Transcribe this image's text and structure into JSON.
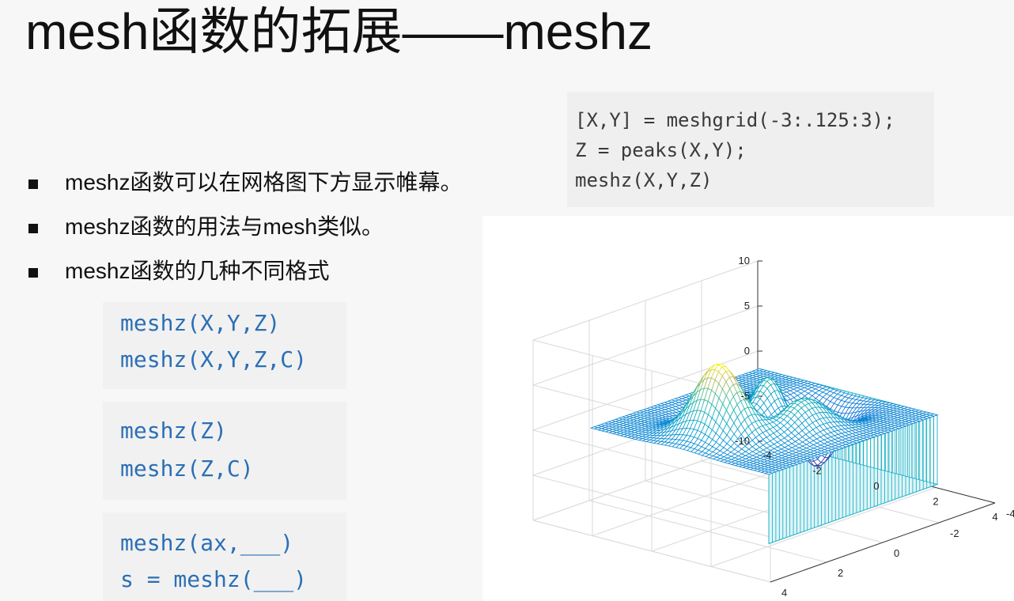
{
  "slide": {
    "title": "mesh函数的拓展——meshz",
    "bullets": [
      "meshz函数可以在网格图下方显示帷幕。",
      "meshz函数的用法与mesh类似。",
      "meshz函数的几种不同格式"
    ]
  },
  "code_example": [
    "[X,Y] = meshgrid(-3:.125:3);",
    "Z = peaks(X,Y);",
    "meshz(X,Y,Z)"
  ],
  "syntax_boxes": [
    [
      "meshz(X,Y,Z)",
      "meshz(X,Y,Z,C)"
    ],
    [
      "meshz(Z)",
      "meshz(Z,C)"
    ],
    [
      "meshz(ax,___)",
      "s = meshz(___)"
    ]
  ],
  "chart_data": {
    "type": "surface",
    "function": "peaks",
    "x_range": [
      -3,
      3
    ],
    "y_range": [
      -3,
      3
    ],
    "xlim": [
      -4,
      4
    ],
    "ylim": [
      -4,
      4
    ],
    "zlim": [
      -10,
      10
    ],
    "z_ticks": [
      "10",
      "5",
      "0",
      "-5",
      "-10"
    ],
    "x_ticks": [
      "-4",
      "-2",
      "0",
      "2",
      "4"
    ],
    "y_ticks": [
      "4",
      "2",
      "0",
      "-2",
      "-4"
    ],
    "grid": true,
    "curtain": true,
    "colormap": "parula"
  }
}
